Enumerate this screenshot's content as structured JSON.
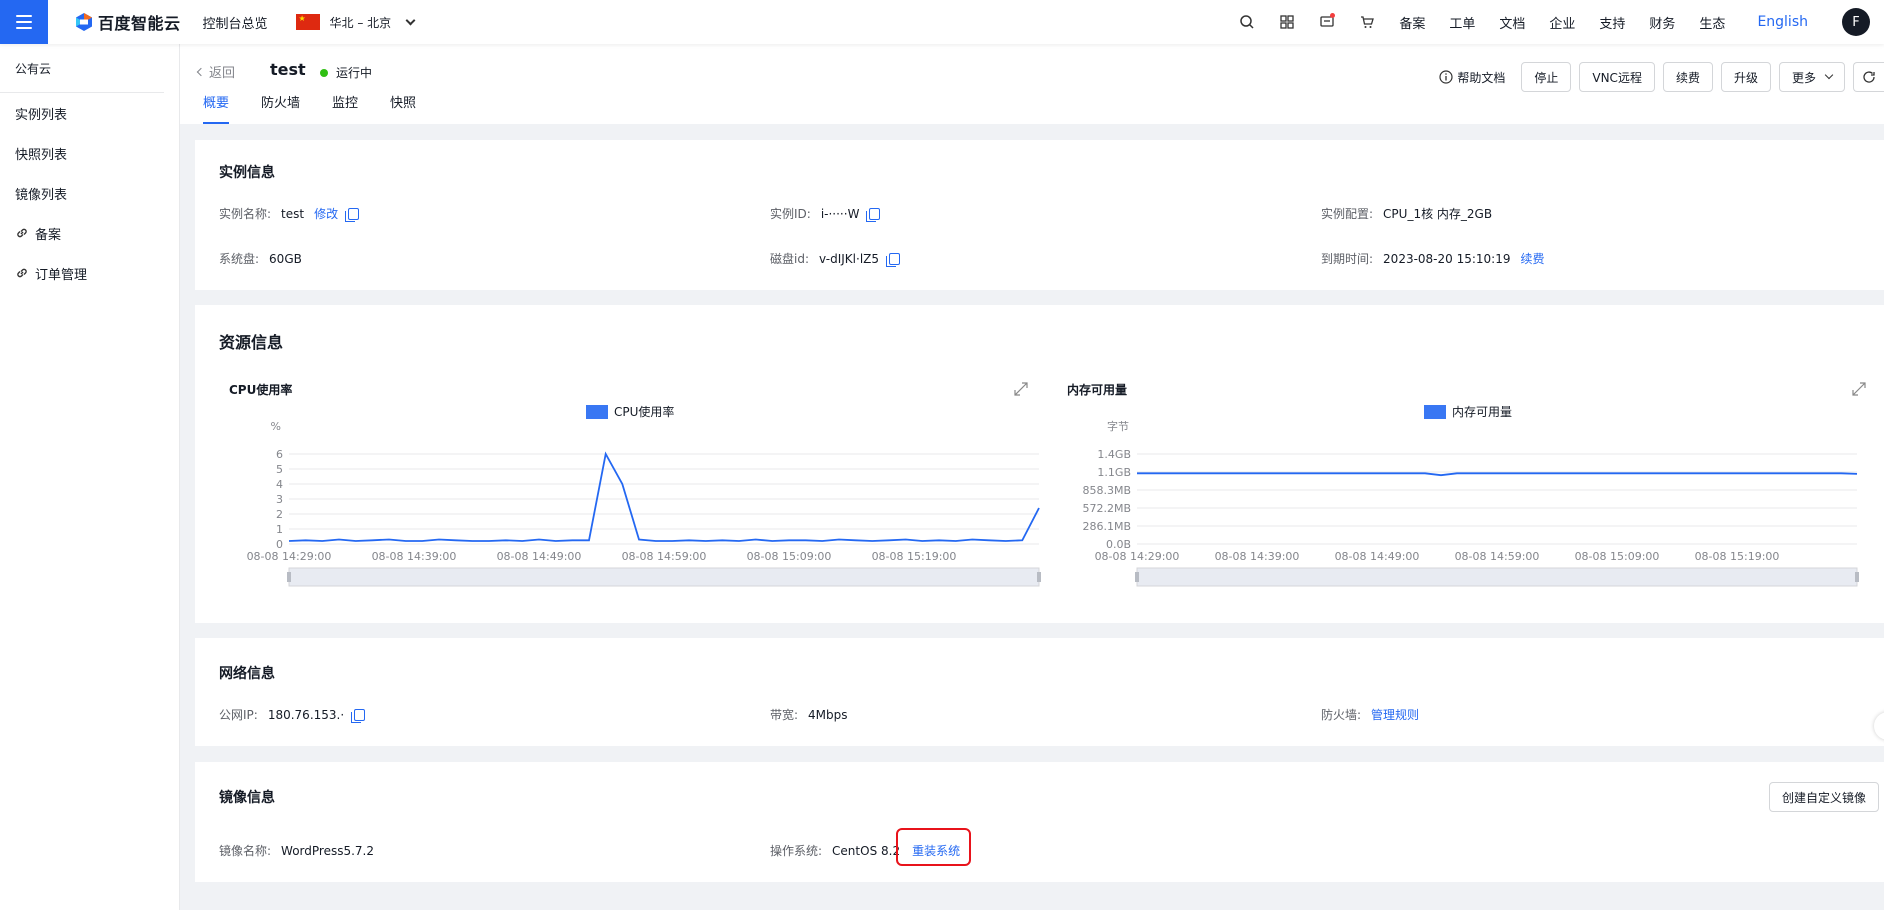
{
  "topbar": {
    "logo_text": "百度智能云",
    "console": "控制台总览",
    "region": "华北 – 北京",
    "links": [
      "备案",
      "工单",
      "文档",
      "企业",
      "支持",
      "财务",
      "生态"
    ],
    "lang": "English",
    "avatar": "F"
  },
  "sidebar": {
    "section": "公有云",
    "items": [
      {
        "label": "实例列表"
      },
      {
        "label": "快照列表"
      },
      {
        "label": "镜像列表"
      },
      {
        "label": "备案"
      },
      {
        "label": "订单管理"
      }
    ]
  },
  "header": {
    "back": "返回",
    "title": "test",
    "status": "运行中",
    "tabs": [
      "概要",
      "防火墙",
      "监控",
      "快照"
    ],
    "help": "帮助文档",
    "buttons": [
      "停止",
      "VNC远程",
      "续费",
      "升级",
      "更多"
    ]
  },
  "instance": {
    "title": "实例信息",
    "name_k": "实例名称:",
    "name_v": "test",
    "edit": "修改",
    "id_k": "实例ID:",
    "id_v": "i-·····W",
    "config_k": "实例配置:",
    "config_v": "CPU_1核 内存_2GB",
    "disk_k": "系统盘:",
    "disk_v": "60GB",
    "diskid_k": "磁盘id:",
    "diskid_v": "v-dIJKl·lZ5",
    "expire_k": "到期时间:",
    "expire_v": "2023-08-20 15:10:19",
    "renew": "续费"
  },
  "resource": {
    "title": "资源信息"
  },
  "chart_data": [
    {
      "type": "line",
      "title": "CPU使用率",
      "ylabel": "%",
      "legend": [
        "CPU使用率"
      ],
      "ylim": [
        0,
        6
      ],
      "yticks": [
        "6",
        "5",
        "4",
        "3",
        "2",
        "1",
        "0"
      ],
      "xticks": [
        "08-08 14:29:00",
        "08-08 14:39:00",
        "08-08 14:49:00",
        "08-08 14:59:00",
        "08-08 15:09:00",
        "08-08 15:19:00"
      ],
      "series": [
        {
          "name": "CPU使用率",
          "values": [
            0.2,
            0.25,
            0.2,
            0.3,
            0.2,
            0.25,
            0.3,
            0.2,
            0.2,
            0.3,
            0.25,
            0.2,
            0.2,
            0.25,
            0.2,
            0.3,
            0.2,
            0.25,
            0.25,
            6.0,
            4.0,
            0.3,
            0.2,
            0.2,
            0.25,
            0.2,
            0.25,
            0.2,
            0.3,
            0.2,
            0.25,
            0.25,
            0.2,
            0.3,
            0.25,
            0.2,
            0.25,
            0.3,
            0.2,
            0.25,
            0.2,
            0.3,
            0.25,
            0.2,
            0.25,
            2.4
          ]
        }
      ]
    },
    {
      "type": "line",
      "title": "内存可用量",
      "ylabel": "字节",
      "legend": [
        "内存可用量"
      ],
      "ylim": [
        0,
        1.4
      ],
      "yticks": [
        "1.4GB",
        "1.1GB",
        "858.3MB",
        "572.2MB",
        "286.1MB",
        "0.0B"
      ],
      "xticks": [
        "08-08 14:29:00",
        "08-08 14:39:00",
        "08-08 14:49:00",
        "08-08 14:59:00",
        "08-08 15:09:00",
        "08-08 15:19:00"
      ],
      "series": [
        {
          "name": "内存可用量",
          "values": [
            1.1,
            1.1,
            1.1,
            1.1,
            1.1,
            1.1,
            1.1,
            1.1,
            1.1,
            1.1,
            1.1,
            1.1,
            1.1,
            1.1,
            1.1,
            1.1,
            1.1,
            1.1,
            1.1,
            1.07,
            1.1,
            1.1,
            1.1,
            1.1,
            1.1,
            1.1,
            1.1,
            1.1,
            1.1,
            1.1,
            1.1,
            1.1,
            1.1,
            1.1,
            1.1,
            1.1,
            1.1,
            1.1,
            1.1,
            1.1,
            1.1,
            1.1,
            1.1,
            1.1,
            1.1,
            1.09
          ]
        }
      ]
    }
  ],
  "network": {
    "title": "网络信息",
    "ip_k": "公网IP:",
    "ip_v": "180.76.153.·",
    "bw_k": "带宽:",
    "bw_v": "4Mbps",
    "fw_k": "防火墙:",
    "fw_v": "管理规则"
  },
  "image": {
    "title": "镜像信息",
    "create_btn": "创建自定义镜像",
    "name_k": "镜像名称:",
    "name_v": "WordPress5.7.2",
    "os_k": "操作系统:",
    "os_v": "CentOS 8.2",
    "reinstall": "重装系统"
  }
}
